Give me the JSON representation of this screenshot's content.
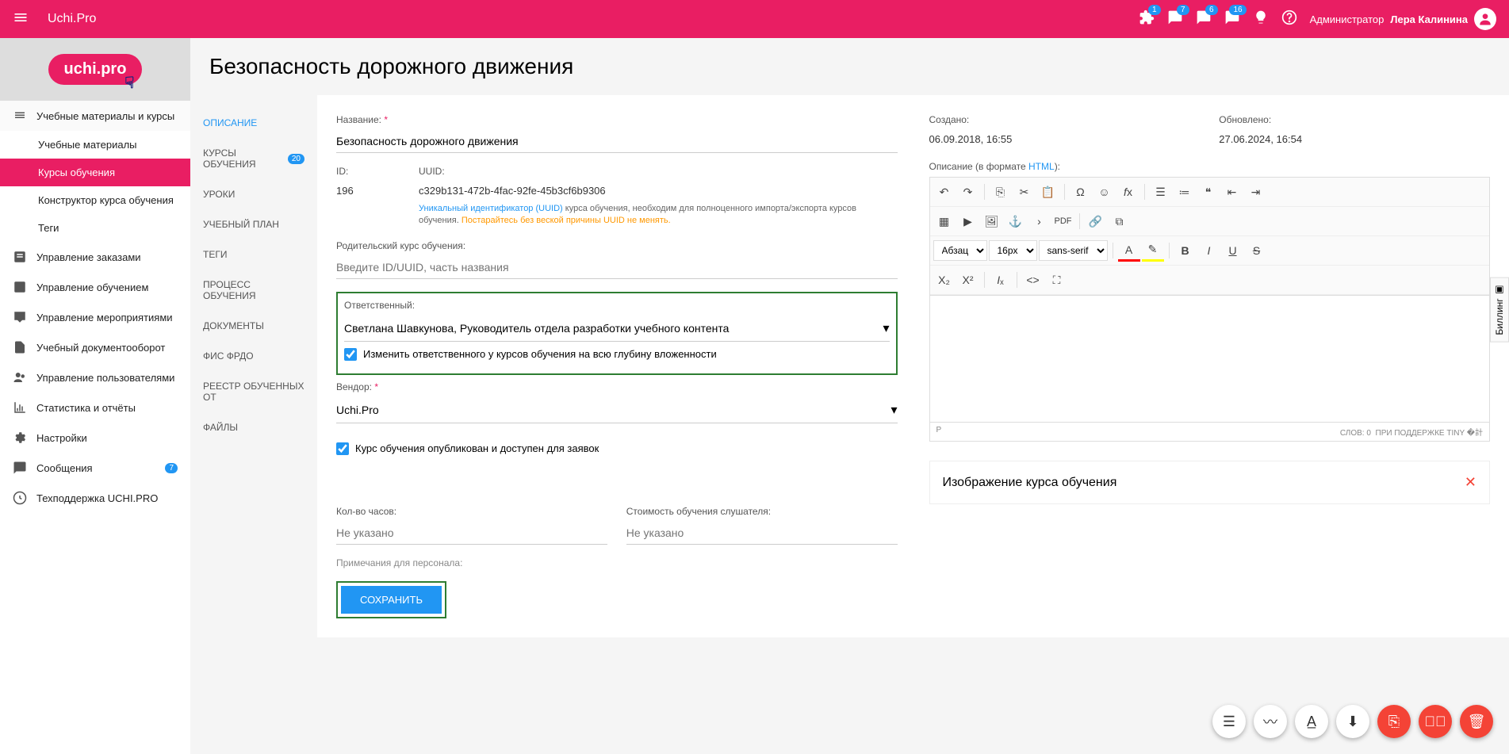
{
  "header": {
    "app_title": "Uchi.Pro",
    "badges": {
      "puzzle": "1",
      "chat1": "7",
      "chat2": "6",
      "chat3": "16"
    },
    "user_role": "Администратор",
    "user_name": "Лера Калинина"
  },
  "sidebar": {
    "logo_text": "uchi.pro",
    "items": [
      {
        "icon": "library",
        "label": "Учебные материалы и курсы"
      },
      {
        "icon": "",
        "label": "Учебные материалы",
        "sub": true
      },
      {
        "icon": "",
        "label": "Курсы обучения",
        "sub": true,
        "active": true
      },
      {
        "icon": "",
        "label": "Конструктор курса обучения",
        "sub": true
      },
      {
        "icon": "",
        "label": "Теги",
        "sub": true
      },
      {
        "icon": "cart",
        "label": "Управление заказами"
      },
      {
        "icon": "clipboard",
        "label": "Управление обучением"
      },
      {
        "icon": "cast",
        "label": "Управление мероприятиями"
      },
      {
        "icon": "doc",
        "label": "Учебный документооборот"
      },
      {
        "icon": "users",
        "label": "Управление пользователями"
      },
      {
        "icon": "stats",
        "label": "Статистика и отчёты"
      },
      {
        "icon": "gear",
        "label": "Настройки"
      },
      {
        "icon": "msg",
        "label": "Сообщения",
        "badge": "7"
      },
      {
        "icon": "support",
        "label": "Техподдержка UCHI.PRO"
      }
    ]
  },
  "page_title": "Безопасность дорожного движения",
  "tabs": [
    {
      "label": "ОПИСАНИЕ",
      "active": true
    },
    {
      "label": "КУРСЫ ОБУЧЕНИЯ",
      "badge": "20"
    },
    {
      "label": "УРОКИ"
    },
    {
      "label": "УЧЕБНЫЙ ПЛАН"
    },
    {
      "label": "ТЕГИ"
    },
    {
      "label": "ПРОЦЕСС ОБУЧЕНИЯ"
    },
    {
      "label": "ДОКУМЕНТЫ"
    },
    {
      "label": "ФИС ФРДО"
    },
    {
      "label": "РЕЕСТР ОБУЧЕННЫХ ОТ"
    },
    {
      "label": "ФАЙЛЫ"
    }
  ],
  "form": {
    "name_label": "Название:",
    "name_value": "Безопасность дорожного движения",
    "id_label": "ID:",
    "id_value": "196",
    "uuid_label": "UUID:",
    "uuid_value": "c329b131-472b-4fac-92fe-45b3cf6b9306",
    "uuid_help_link": "Уникальный идентификатор (UUID)",
    "uuid_help_text": " курса обучения, необходим для полноценного импорта/экспорта курсов обучения. ",
    "uuid_warn": "Постарайтесь без веской причины UUID не менять.",
    "parent_label": "Родительский курс обучения:",
    "parent_placeholder": "Введите ID/UUID, часть названия",
    "responsible_label": "Ответственный:",
    "responsible_value": "Светлана Шавкунова, Руководитель отдела разработки учебного контента",
    "responsible_check": "Изменить ответственного у курсов обучения на всю глубину вложенности",
    "vendor_label": "Вендор:",
    "vendor_value": "Uchi.Pro",
    "published_check": "Курс обучения опубликован и доступен для заявок",
    "hours_label": "Кол-во часов:",
    "hours_placeholder": "Не указано",
    "cost_label": "Стоимость обучения слушателя:",
    "cost_placeholder": "Не указано",
    "notes_label": "Примечания для персонала:",
    "save_button": "СОХРАНИТЬ"
  },
  "right": {
    "created_label": "Создано:",
    "created_value": "06.09.2018, 16:55",
    "updated_label": "Обновлено:",
    "updated_value": "27.06.2024, 16:54",
    "desc_label": "Описание (в формате ",
    "desc_link": "HTML",
    "desc_suffix": "):",
    "editor_paragraph": "Абзац",
    "editor_fontsize": "16px",
    "editor_fontfamily": "sans-serif",
    "editor_footer_p": "P",
    "editor_footer_words": "СЛОВ: 0",
    "editor_footer_tiny": "ПРИ ПОДДЕРЖКЕ TINY",
    "image_card_title": "Изображение курса обучения"
  },
  "billing_label": "Биллинг"
}
